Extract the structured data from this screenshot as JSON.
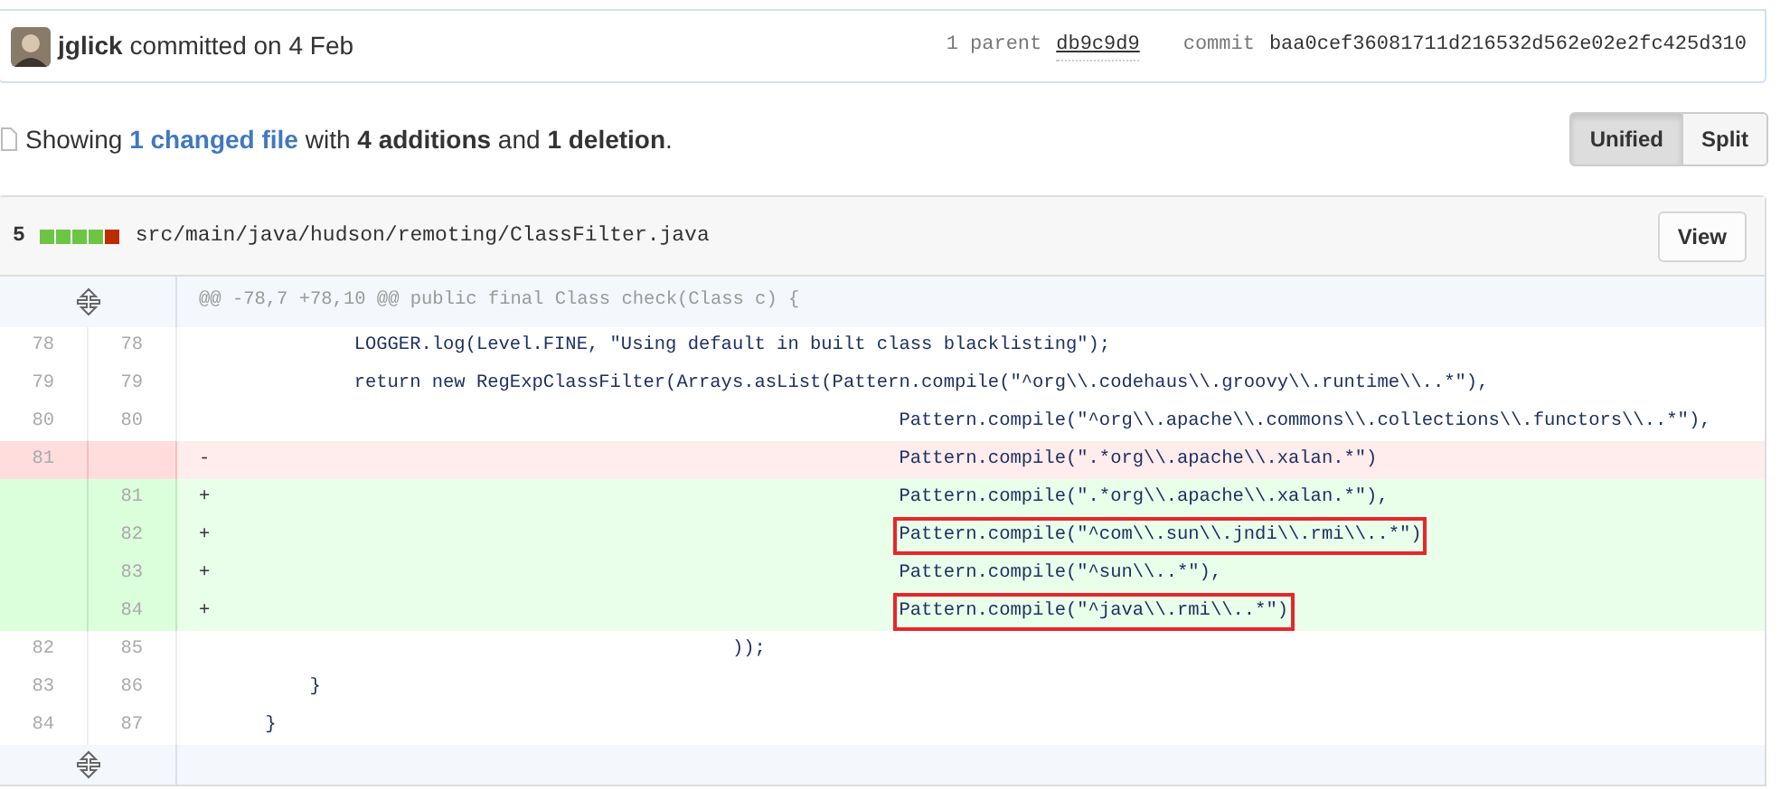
{
  "commit": {
    "author": "jglick",
    "action": "committed on 4 Feb",
    "parent_label": "1 parent",
    "parent_sha": "db9c9d9",
    "commit_label": "commit",
    "sha": "baa0cef36081711d216532d562e02e2fc425d310"
  },
  "summary": {
    "prefix": "Showing",
    "link": "1 changed file",
    "rest": "with **4 additions** and **1 deletion**."
  },
  "view_toggle": [
    {
      "label": "Unified",
      "selected": true
    },
    {
      "label": "Split",
      "selected": false
    }
  ],
  "file": {
    "count": "5",
    "diffstat": [
      {
        "kind": "add"
      },
      {
        "kind": "add"
      },
      {
        "kind": "add"
      },
      {
        "kind": "add"
      },
      {
        "kind": "del"
      }
    ],
    "path": "src/main/java/hudson/remoting/ClassFilter.java",
    "view_button": "View",
    "hunk": "@@ -78,7 +78,10 @@ public final Class check(Class c) {",
    "lines": [
      {
        "kind": "context",
        "old": "78",
        "new": "78",
        "code": "            LOGGER.log(Level.FINE, \"Using default in built class blacklisting\");",
        "highlighted": false
      },
      {
        "kind": "context",
        "old": "79",
        "new": "79",
        "code": "            return new RegExpClassFilter(Arrays.asList(Pattern.compile(\"^org\\\\.codehaus\\\\.groovy\\\\.runtime\\\\..*\"),",
        "highlighted": false
      },
      {
        "kind": "context",
        "old": "80",
        "new": "80",
        "code": "                                                             Pattern.compile(\"^org\\\\.apache\\\\.commons\\\\.collections\\\\.functors\\\\..*\"),",
        "highlighted": false
      },
      {
        "kind": "del",
        "old": "81",
        "sign": "-",
        "code": "                                                             Pattern.compile(\".*org\\\\.apache\\\\.xalan.*\")",
        "highlighted": false
      },
      {
        "kind": "add",
        "new": "81",
        "sign": "+",
        "code": "                                                             Pattern.compile(\".*org\\\\.apache\\\\.xalan.*\"),",
        "highlighted": false
      },
      {
        "kind": "add",
        "new": "82",
        "sign": "+",
        "code": "                                                             Pattern.compile(\"^com\\\\.sun\\\\.jndi\\\\.rmi\\\\..*\")",
        "highlighted": true
      },
      {
        "kind": "add",
        "new": "83",
        "sign": "+",
        "code": "                                                             Pattern.compile(\"^sun\\\\..*\"),",
        "highlighted": false
      },
      {
        "kind": "add",
        "new": "84",
        "sign": "+",
        "code": "                                                             Pattern.compile(\"^java\\\\.rmi\\\\..*\")",
        "highlighted": true
      },
      {
        "kind": "context",
        "old": "82",
        "new": "85",
        "code": "                                              ));",
        "highlighted": false
      },
      {
        "kind": "context",
        "old": "83",
        "new": "86",
        "code": "        }",
        "highlighted": false
      },
      {
        "kind": "context",
        "old": "84",
        "new": "87",
        "code": "    }",
        "highlighted": false
      }
    ]
  }
}
